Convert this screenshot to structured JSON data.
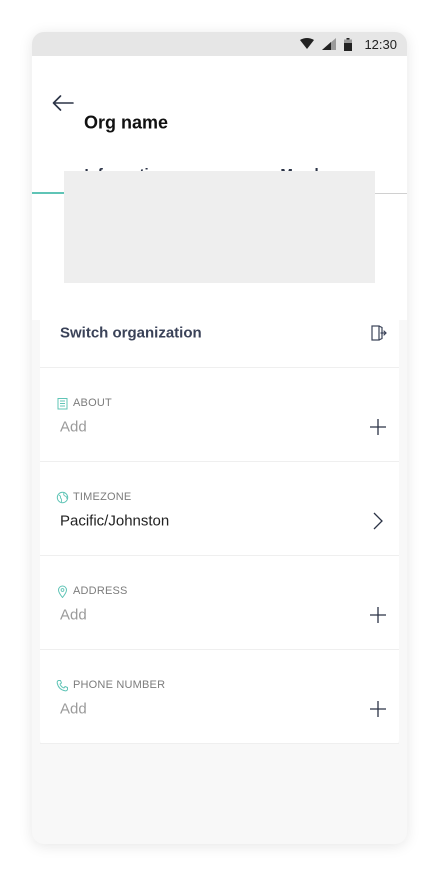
{
  "status_bar": {
    "time": "12:30",
    "icons": [
      "wifi-icon",
      "signal-icon",
      "battery-icon"
    ]
  },
  "header": {
    "back_icon": "arrow-left-icon",
    "title": "Org name"
  },
  "tabs": [
    {
      "label": "Information",
      "active": true
    },
    {
      "label": "Members",
      "active": false
    }
  ],
  "switch_org": {
    "label": "Switch organization",
    "icon": "exit-door-icon"
  },
  "fields": [
    {
      "label": "ABOUT",
      "icon": "building-icon",
      "value": "Add",
      "action_icon": "plus-icon"
    },
    {
      "label": "TIMEZONE",
      "icon": "globe-icon",
      "value": "Pacific/Johnston",
      "action_icon": "chevron-right-icon"
    },
    {
      "label": "ADDRESS",
      "icon": "location-pin-icon",
      "value": "Add",
      "action_icon": "plus-icon"
    },
    {
      "label": "PHONE NUMBER",
      "icon": "phone-icon",
      "value": "Add",
      "action_icon": "plus-icon"
    }
  ],
  "colors": {
    "accent": "#5fc4b6",
    "title_text": "#3a4258",
    "placeholder_text": "#9a9a9a",
    "background": "#f8f8f8"
  }
}
